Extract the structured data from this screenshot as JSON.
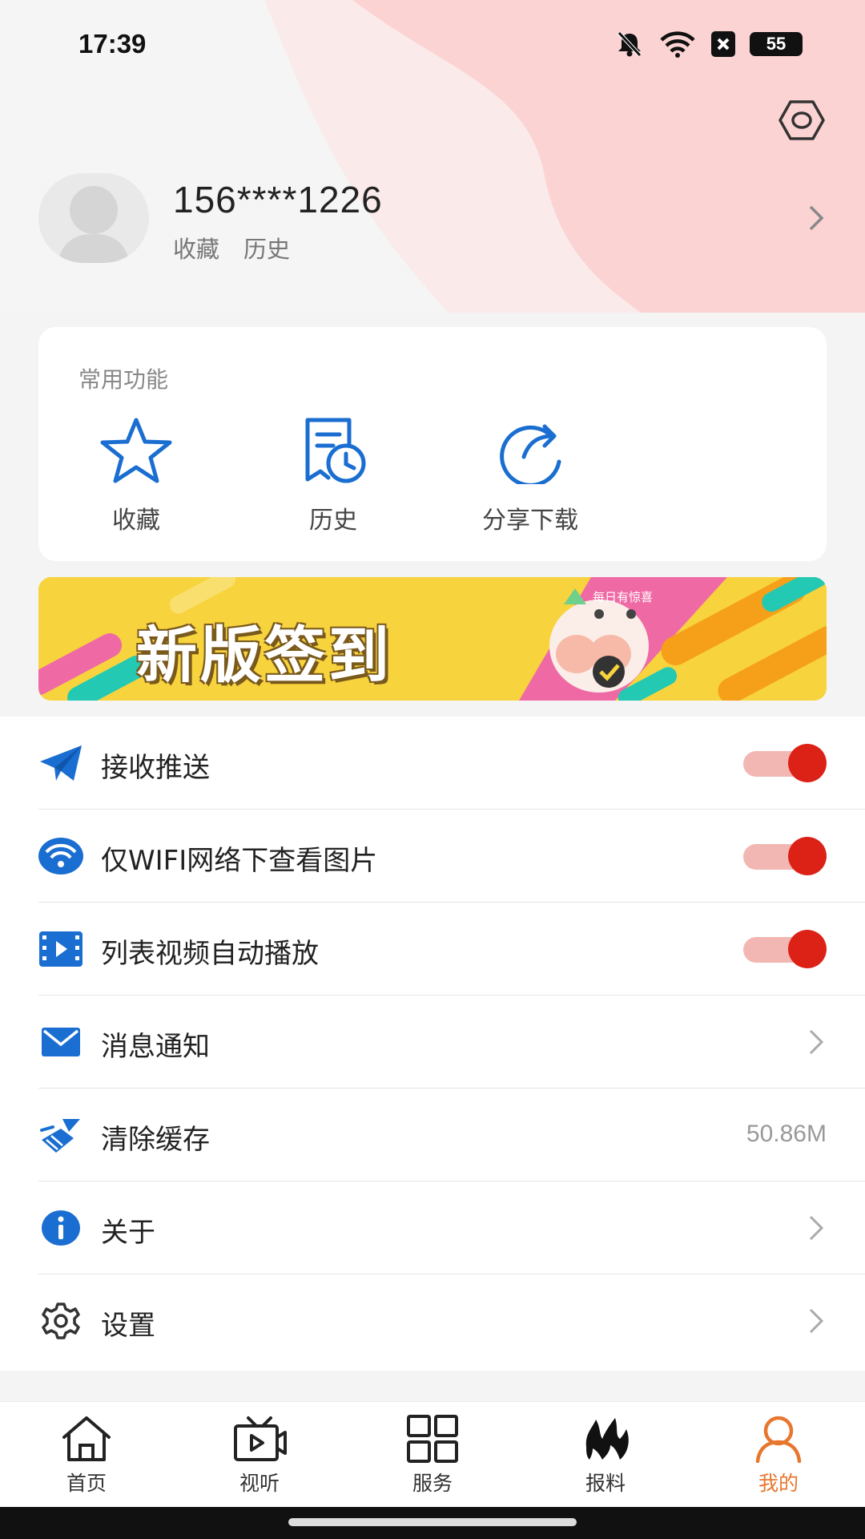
{
  "status_bar": {
    "time": "17:39",
    "battery": "55",
    "icons": [
      "bell-off-icon",
      "wifi-icon",
      "sim-x-icon",
      "battery-icon"
    ]
  },
  "profile": {
    "username": "156****1226",
    "links": [
      "收藏",
      "历史"
    ],
    "settings_icon": "hexagon-settings-icon"
  },
  "common_functions": {
    "title": "常用功能",
    "items": [
      {
        "label": "收藏",
        "icon": "star-icon"
      },
      {
        "label": "历史",
        "icon": "history-doc-icon"
      },
      {
        "label": "分享下载",
        "icon": "share-arrow-icon"
      }
    ]
  },
  "banner": {
    "text": "新版签到",
    "subtext": "每日有惊喜"
  },
  "settings_list": [
    {
      "label": "接收推送",
      "icon": "paper-plane-icon",
      "type": "toggle",
      "on": true
    },
    {
      "label": "仅WIFI网络下查看图片",
      "icon": "wifi-circle-icon",
      "type": "toggle",
      "on": true
    },
    {
      "label": "列表视频自动播放",
      "icon": "video-play-icon",
      "type": "toggle",
      "on": true
    },
    {
      "label": "消息通知",
      "icon": "mail-icon",
      "type": "chevron"
    },
    {
      "label": "清除缓存",
      "icon": "broom-icon",
      "type": "value",
      "value": "50.86M"
    },
    {
      "label": "关于",
      "icon": "info-icon",
      "type": "chevron"
    },
    {
      "label": "设置",
      "icon": "gear-icon",
      "type": "chevron"
    }
  ],
  "bottom_nav": [
    {
      "label": "首页",
      "icon": "home-icon",
      "active": false
    },
    {
      "label": "视听",
      "icon": "tv-play-icon",
      "active": false
    },
    {
      "label": "服务",
      "icon": "grid-icon",
      "active": false
    },
    {
      "label": "报料",
      "icon": "flame-icon",
      "active": false
    },
    {
      "label": "我的",
      "icon": "person-icon",
      "active": true
    }
  ],
  "colors": {
    "accent_blue": "#1a6ed1",
    "toggle_on": "#dc2117",
    "toggle_track": "#f2b7b3",
    "active_nav": "#e8772e",
    "header_pink": "#fcd3d3"
  }
}
